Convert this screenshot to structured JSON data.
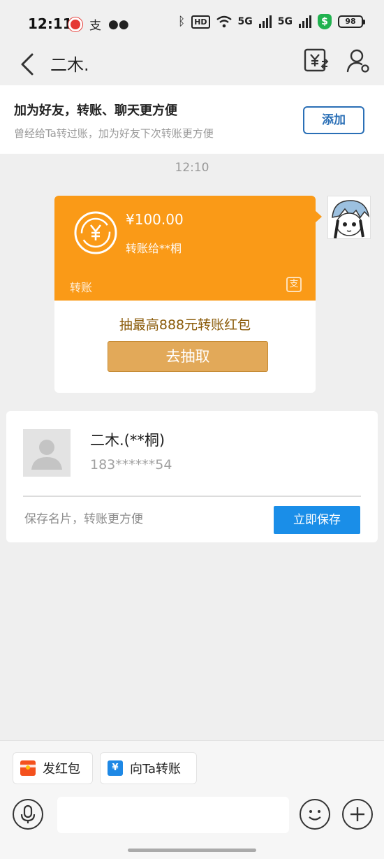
{
  "status_bar": {
    "time": "12:11",
    "left_icons": [
      "app-notification-icon",
      "alipay-icon",
      "wechat-icon"
    ],
    "network_5g_a": "5G",
    "network_5g_b": "5G",
    "hd_label": "HD",
    "shield_symbol": "$",
    "battery": "98"
  },
  "nav": {
    "title": "二木.",
    "back_icon": "chevron-left-icon",
    "transfer_icon": "yuan-transfer-icon",
    "profile_icon": "person-settings-icon"
  },
  "friend_banner": {
    "title": "加为好友，转账、聊天更方便",
    "subtitle": "曾经给Ta转过账，加为好友下次转账更方便",
    "add_label": "添加"
  },
  "chat": {
    "time": "12:10"
  },
  "transfer_card": {
    "amount": "¥100.00",
    "description": "转账给**桐",
    "label": "转账",
    "promo_text": "抽最高888元转账红包",
    "draw_label": "去抽取",
    "colors": {
      "accent": "#fa9a17",
      "promo": "#8a5a08",
      "button": "#e2a959"
    }
  },
  "contact_card": {
    "name": "二木.(**桐)",
    "phone": "183******54",
    "hint": "保存名片，转账更方便",
    "save_label": "立即保存",
    "colors": {
      "button": "#1a8ee8"
    }
  },
  "bottom": {
    "red_packet_label": "发红包",
    "transfer_label": "向Ta转账",
    "input_placeholder": "",
    "input_value": ""
  }
}
